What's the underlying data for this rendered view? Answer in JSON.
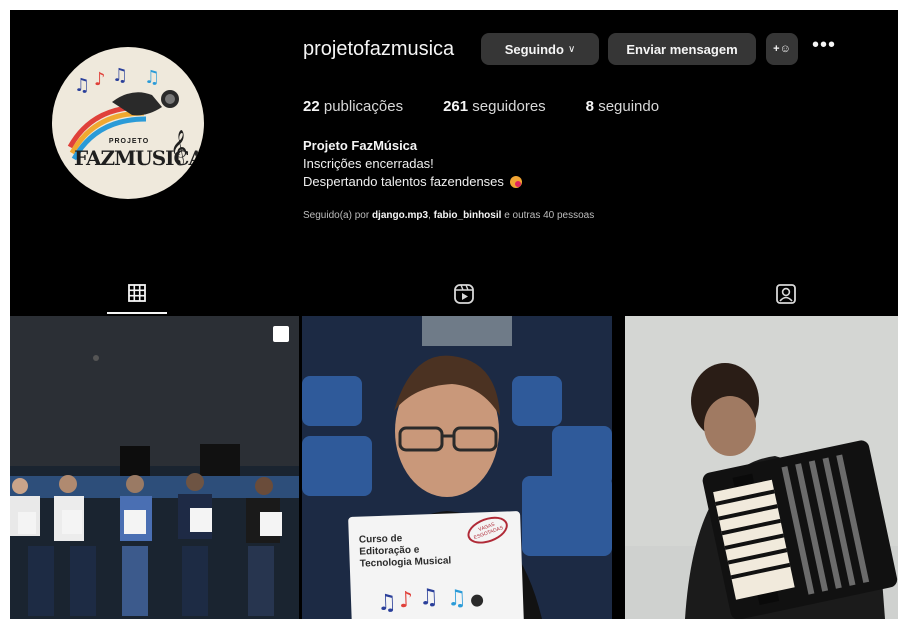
{
  "profile": {
    "username": "projetofazmusica",
    "logo_line1": "PROJETO",
    "logo_line2": "FAZMUSICA",
    "avatar_icon": "logo-music-notes-microphone",
    "follow_button": "Seguindo",
    "follow_chevron": "∨",
    "message_button": "Enviar mensagem",
    "add_user_icon": "add-person-icon",
    "add_user_glyph": "+☺",
    "more_icon": "more-options-icon",
    "more_glyph": "•••",
    "stats": {
      "posts_count": "22",
      "posts_label": "publicações",
      "followers_count": "261",
      "followers_label": "seguidores",
      "following_count": "8",
      "following_label": "seguindo"
    },
    "bio": {
      "name": "Projeto FazMúsica",
      "line1": "Inscrições encerradas!",
      "line2": "Despertando talentos fazendenses"
    },
    "followed_by": {
      "prefix": "Seguido(a) por",
      "user1": "django.mp3",
      "sep": ",",
      "user2": "fabio_binhosil",
      "suffix": "e outras 40 pessoas"
    }
  },
  "tabs": [
    {
      "name": "posts",
      "icon": "grid-icon",
      "active": true
    },
    {
      "name": "reels",
      "icon": "reels-icon",
      "active": false
    },
    {
      "name": "tagged",
      "icon": "tagged-icon",
      "active": false
    }
  ],
  "posts": [
    {
      "multi": true
    },
    {
      "book_title": "Curso de\nEditoração e\nTecnologia Musical",
      "stamp": "VAGAS ESGOTADAS"
    },
    {}
  ],
  "colors": {
    "background": "#000000",
    "button": "#363636",
    "text": "#f5f5f5",
    "secondary": "#bdbdbd"
  }
}
